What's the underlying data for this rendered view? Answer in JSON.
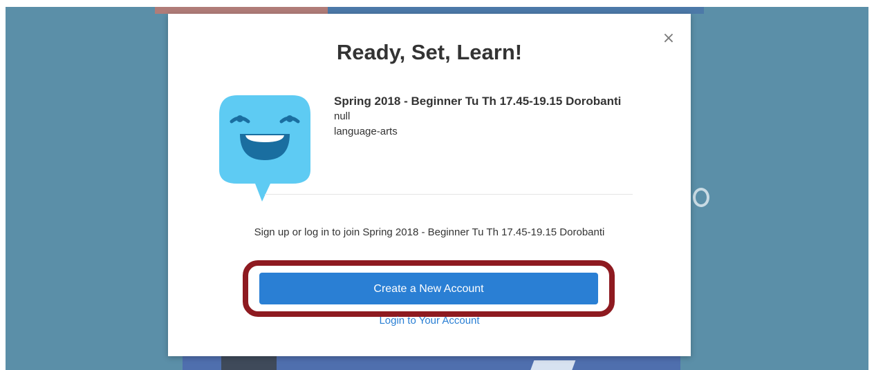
{
  "modal": {
    "close_symbol": "×",
    "title": "Ready, Set, Learn!",
    "class": {
      "name": "Spring 2018 - Beginner Tu Th 17.45-19.15 Dorobanti",
      "line1": "null",
      "line2": "language-arts"
    },
    "signup_text": "Sign up or log in to join Spring 2018 - Beginner Tu Th 17.45-19.15 Dorobanti",
    "create_button_label": "Create a New Account",
    "login_link_label": "Login to Your Account"
  },
  "icons": {
    "close": "close-icon",
    "mascot": "smiling-mascot-icon"
  },
  "colors": {
    "backdrop": "#5b8fa8",
    "primary": "#2a7fd4",
    "highlight": "#8e1a20",
    "mascot": "#5ecbf3"
  }
}
